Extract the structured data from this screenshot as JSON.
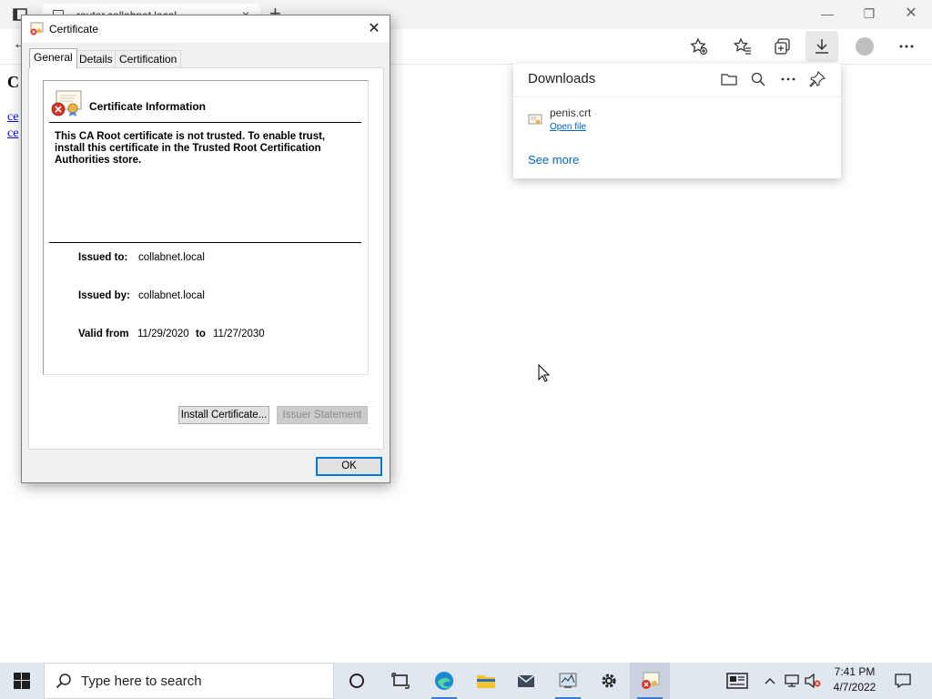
{
  "browser": {
    "tab_title": "router.collabnet.local",
    "tab_close": "×",
    "new_tab": "+",
    "window_minimize": "—",
    "window_restore": "❐",
    "window_close": "✕",
    "back": "←"
  },
  "page": {
    "heading": "C",
    "links": [
      "ce",
      "ce"
    ]
  },
  "downloads": {
    "title": "Downloads",
    "items": [
      {
        "filename": "penis.crt",
        "action": "Open file"
      }
    ],
    "see_more": "See more"
  },
  "dialog": {
    "title": "Certificate",
    "close": "✕",
    "tabs": [
      "General",
      "Details",
      "Certification Path"
    ],
    "active_tab": "General",
    "info_title": "Certificate Information",
    "warning": "This CA Root certificate is not trusted. To enable trust, install this certificate in the Trusted Root Certification Authorities store.",
    "issued_to_label": "Issued to:",
    "issued_to": "collabnet.local",
    "issued_by_label": "Issued by:",
    "issued_by": "collabnet.local",
    "valid_from_label": "Valid from",
    "valid_from": "11/29/2020",
    "to_label": "to",
    "valid_to": "11/27/2030",
    "install_button": "Install Certificate...",
    "issuer_statement_button": "Issuer Statement",
    "ok_button": "OK"
  },
  "taskbar": {
    "search_placeholder": "Type here to search",
    "time": "7:41 PM",
    "date": "4/7/2022"
  },
  "colors": {
    "accent": "#0078d7",
    "link": "#0067c0",
    "taskbar": "#e1e7ef"
  }
}
